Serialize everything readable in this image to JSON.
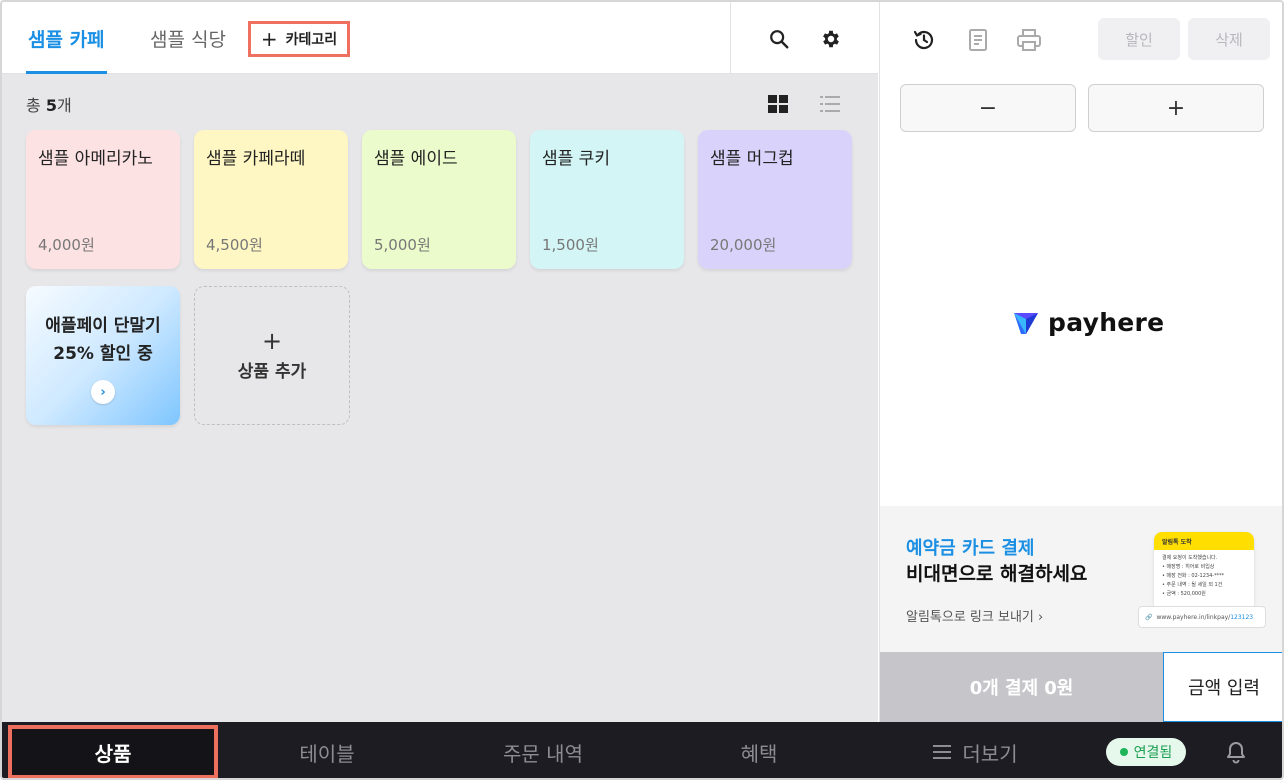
{
  "header": {
    "tabs": [
      {
        "label": "샘플 카페",
        "active": true
      },
      {
        "label": "샘플 식당",
        "active": false
      }
    ],
    "add_category_label": "카테고리",
    "icons": {
      "search": "search-icon",
      "settings": "gear-icon"
    }
  },
  "products": {
    "count_prefix": "총 ",
    "count_value": "5",
    "count_suffix": "개",
    "view_icons": {
      "grid": "grid-view-icon",
      "list": "list-view-icon"
    },
    "items": [
      {
        "name": "샘플 아메리카노",
        "price": "4,000원",
        "color": "#fde2e4"
      },
      {
        "name": "샘플 카페라떼",
        "price": "4,500원",
        "color": "#fef7c3"
      },
      {
        "name": "샘플 에이드",
        "price": "5,000원",
        "color": "#ebfbcb"
      },
      {
        "name": "샘플 쿠키",
        "price": "1,500원",
        "color": "#d3f5f5"
      },
      {
        "name": "샘플 머그컵",
        "price": "20,000원",
        "color": "#d9d3fb"
      }
    ],
    "promo": {
      "line1": "애플페이 단말기",
      "line2": "25% 할인 중",
      "arrow": "›"
    },
    "add_product_label": "상품 추가"
  },
  "order_panel": {
    "icons": {
      "history": "history-icon",
      "receipt": "receipt-icon",
      "print": "printer-icon"
    },
    "discount_label": "할인",
    "delete_label": "삭제",
    "minus_label": "−",
    "plus_label": "+",
    "logo_text": "payhere",
    "banner": {
      "title_blue": "예약금 카드 결제",
      "title_black": "비대면으로 해결하세요",
      "link_text": "알림톡으로 링크 보내기",
      "phone_header": "알림톡 도착",
      "phone_lines": [
        "결제 요청이 도착했습니다.",
        "• 매장명 : 히어로 비입상",
        "• 매장 전화 : 02-1234-****",
        "• 주문 내역 : 될 세일 외 1건",
        "• 금액 : 520,000원"
      ],
      "url_prefix": "www.payhere.in/linkpay/",
      "url_id": "123123"
    },
    "pay_count": "0개 결제",
    "pay_amount": "0원",
    "amount_input_label": "금액 입력"
  },
  "bottom_nav": {
    "items": [
      {
        "label": "상품",
        "active": true
      },
      {
        "label": "테이블",
        "active": false
      },
      {
        "label": "주문 내역",
        "active": false
      },
      {
        "label": "혜택",
        "active": false
      },
      {
        "label": "더보기",
        "active": false
      }
    ],
    "status": "연결됨",
    "icons": {
      "menu": "hamburger-icon",
      "bell": "bell-icon"
    }
  }
}
